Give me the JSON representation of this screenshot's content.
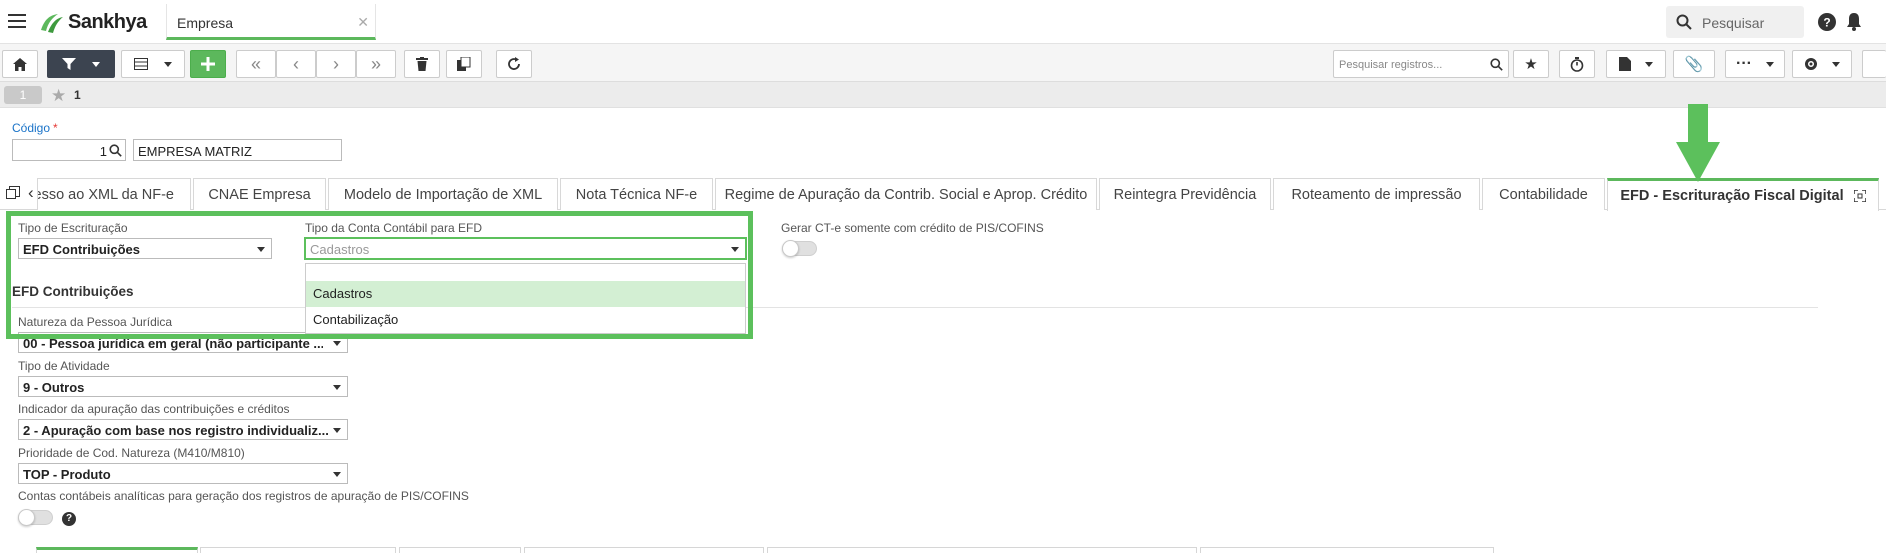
{
  "topbar": {
    "brand": "Sankhya",
    "open_tab": "Empresa",
    "search_placeholder": "Pesquisar"
  },
  "toolbar": {
    "record_search_placeholder": "Pesquisar registros..."
  },
  "navigation": {
    "page": "1",
    "favorites_count": "1"
  },
  "form": {
    "codigo_label": "Código",
    "required_mark": "*",
    "codigo_value": "1",
    "empresa_value": "EMPRESA MATRIZ"
  },
  "tabs": [
    "Acesso ao XML da NF-e",
    "CNAE Empresa",
    "Modelo de Importação de XML",
    "Nota Técnica NF-e",
    "Regime de Apuração da Contrib. Social e Aprop. Crédito",
    "Reintegra Previdência",
    "Roteamento de impressão",
    "Contabilidade",
    "EFD - Escrituração Fiscal Digital"
  ],
  "efd": {
    "tipo_escrituracao_label": "Tipo de Escrituração",
    "tipo_escrituracao_value": "EFD Contribuições",
    "tipo_conta_label": "Tipo da Conta Contábil para EFD",
    "tipo_conta_value": "Cadastros",
    "tipo_conta_options": [
      "Cadastros",
      "Contabilização"
    ],
    "gerar_cte_label": "Gerar CT-e somente com crédito de PIS/COFINS",
    "section_title": "EFD Contribuições",
    "natureza_label": "Natureza da Pessoa Jurídica",
    "natureza_value": "00 - Pessoa jurídica em geral (não participante ...",
    "tipo_atividade_label": "Tipo de Atividade",
    "tipo_atividade_value": "9 - Outros",
    "indicador_label": "Indicador da apuração das contribuições e créditos",
    "indicador_value": "2 - Apuração com base nos registro individualiz...",
    "prioridade_label": "Prioridade de Cod. Natureza (M410/M810)",
    "prioridade_value": "TOP - Produto",
    "contas_label": "Contas contábeis analíticas para geração dos registros de apuração de PIS/COFINS"
  },
  "colors": {
    "accent_green": "#5cb85c",
    "highlight_green": "#5cc05c",
    "dark_button": "#3c4450",
    "link_blue": "#1a73c8"
  }
}
